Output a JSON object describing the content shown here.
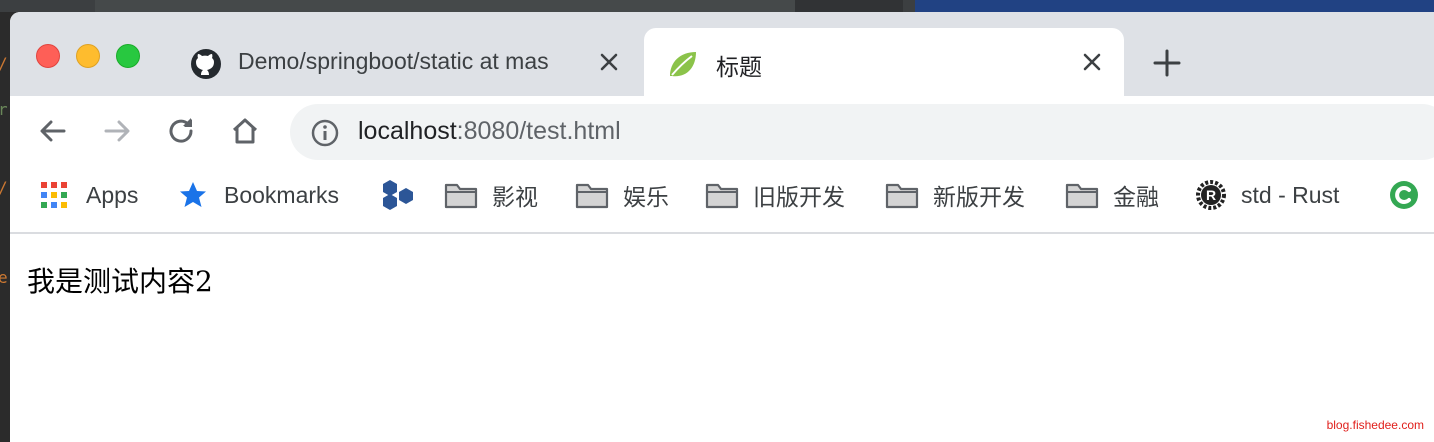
{
  "background": {
    "gutter_chars": [
      "/",
      "r",
      "/",
      "e"
    ]
  },
  "browser": {
    "tabs": [
      {
        "title": "Demo/springboot/static at mas",
        "icon": "github-icon",
        "active": false
      },
      {
        "title": "标题",
        "icon": "spring-leaf-icon",
        "active": true
      }
    ],
    "new_tab_icon": "plus-icon",
    "toolbar": {
      "back_icon": "arrow-left-icon",
      "forward_icon": "arrow-right-icon",
      "reload_icon": "reload-icon",
      "home_icon": "home-icon"
    },
    "address": {
      "host": "localhost",
      "port_path": ":8080/test.html",
      "info_icon": "info-icon"
    },
    "bookmarks": [
      {
        "label": "Apps",
        "icon": "apps-grid-icon"
      },
      {
        "label": "Bookmarks",
        "icon": "star-icon"
      },
      {
        "label": "",
        "icon": "hexagons-icon"
      },
      {
        "label": "影视",
        "icon": "folder-icon"
      },
      {
        "label": "娱乐",
        "icon": "folder-icon"
      },
      {
        "label": "旧版开发",
        "icon": "folder-icon"
      },
      {
        "label": "新版开发",
        "icon": "folder-icon"
      },
      {
        "label": "金融",
        "icon": "folder-icon"
      },
      {
        "label": "std - Rust",
        "icon": "rust-icon"
      },
      {
        "label": "",
        "icon": "green-c-icon"
      }
    ]
  },
  "page": {
    "content": "我是测试内容2"
  },
  "watermark": "blog.fishedee.com",
  "colors": {
    "tabstrip": "#dee1e6",
    "omnibox": "#f1f3f4",
    "traffic_red": "#fe5f57",
    "traffic_yellow": "#febc2e",
    "traffic_green": "#28c840",
    "bookmark_star": "#1a73e8",
    "watermark": "#e0201c"
  }
}
